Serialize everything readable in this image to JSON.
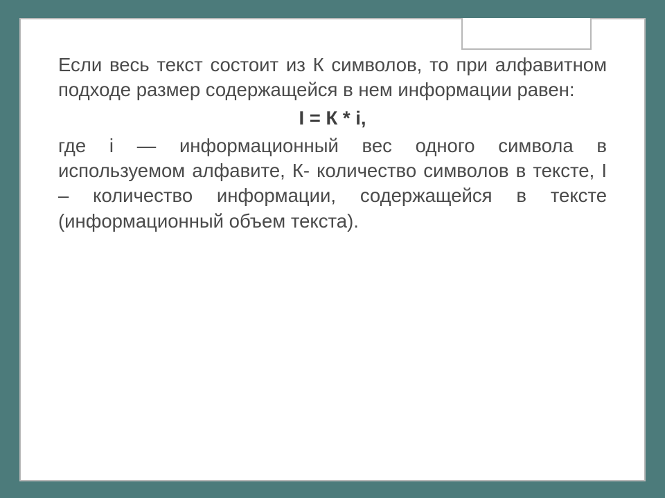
{
  "slide": {
    "para1": "Если весь текст состоит из К символов, то при алфавитном подходе размер содержащейся в нем информации равен:",
    "formula": "I = К * i,",
    "para2": "где i — информационный вес одного символа в используемом алфавите, К- количество символов в тексте, I – количество информации, содержащейся в тексте (информационный объем текста)."
  }
}
